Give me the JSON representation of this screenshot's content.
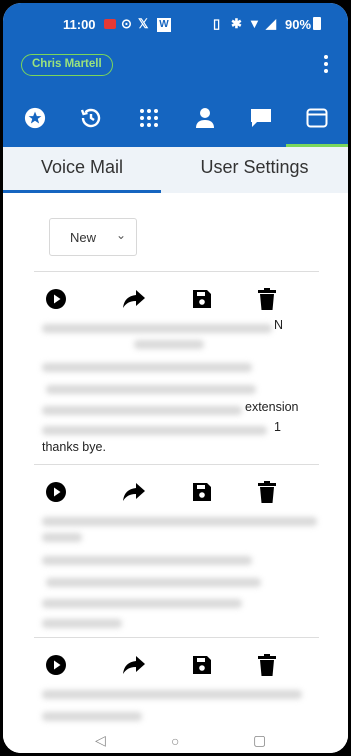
{
  "status_bar": {
    "time": "11:00",
    "battery": "90%"
  },
  "header": {
    "user_name": "Chris Martell"
  },
  "nav": {
    "icons": [
      "favorites-icon",
      "history-icon",
      "dialpad-icon",
      "contacts-icon",
      "messages-icon",
      "voicemail-inbox-icon"
    ],
    "active_index": 5
  },
  "tabs": [
    {
      "label": "Voice Mail",
      "active": true
    },
    {
      "label": "User Settings",
      "active": false
    }
  ],
  "filter": {
    "selected": "New"
  },
  "voicemails": [
    {
      "caller_suffix": "N",
      "transcript_suffix_1": "extension",
      "transcript_suffix_2": "1",
      "transcript_end": "thanks bye."
    },
    {},
    {}
  ],
  "colors": {
    "header": "#1565c0",
    "accent": "#7bd65b"
  }
}
